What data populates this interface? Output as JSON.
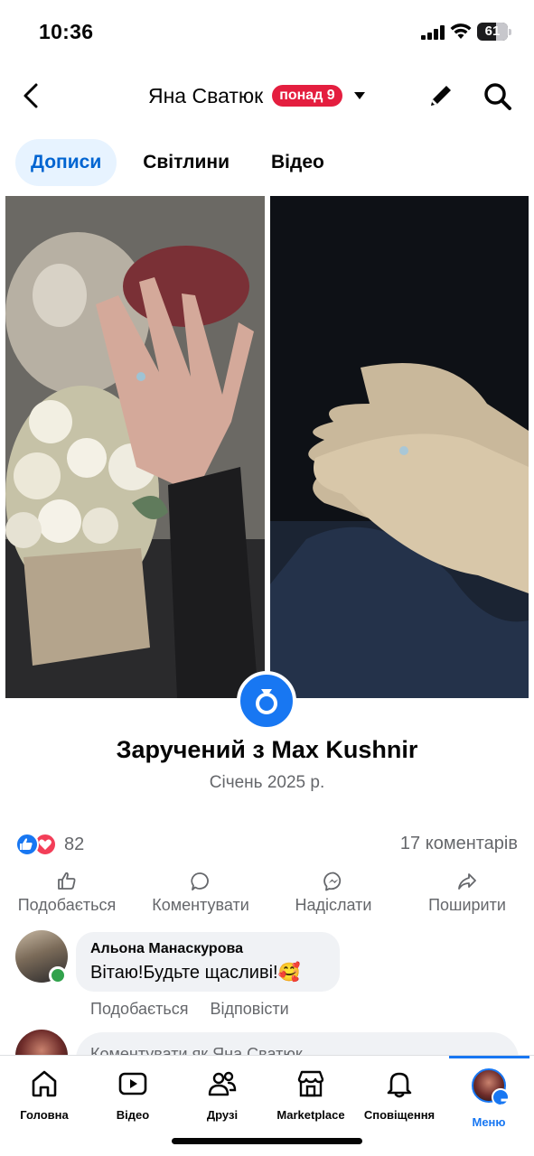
{
  "status_bar": {
    "time": "10:36",
    "battery": "61"
  },
  "header": {
    "title": "Яна Сватюк",
    "badge": "понад 9",
    "icons": [
      "back-icon",
      "chevron-down-icon",
      "edit-icon",
      "search-icon"
    ]
  },
  "tabs": [
    {
      "label": "Дописи",
      "active": true
    },
    {
      "label": "Світлини",
      "active": false
    },
    {
      "label": "Відео",
      "active": false
    }
  ],
  "post": {
    "event_title": "Заручений з Max  Kushnir",
    "event_date": "Січень 2025 р.",
    "reactions_count": "82",
    "comments_count": "17 коментарів",
    "actions": [
      "Подобається",
      "Коментувати",
      "Надіслати",
      "Поширити"
    ]
  },
  "comment": {
    "author": "Альона Манаскурова",
    "text": "Вітаю!Будьте щасливі!🥰",
    "actions": [
      "Подобається",
      "Відповісти"
    ]
  },
  "composer": {
    "placeholder": "Коментувати як Яна Сватюк"
  },
  "bottom_nav": [
    {
      "label": "Головна",
      "icon": "home-icon"
    },
    {
      "label": "Відео",
      "icon": "video-icon"
    },
    {
      "label": "Друзі",
      "icon": "friends-icon"
    },
    {
      "label": "Marketplace",
      "icon": "marketplace-icon"
    },
    {
      "label": "Сповіщення",
      "icon": "bell-icon"
    },
    {
      "label": "Меню",
      "icon": "menu-icon",
      "active": true
    }
  ],
  "colors": {
    "accent": "#1877f2",
    "badge": "#e41e3f",
    "tab_active_bg": "#e7f3ff",
    "secondary_text": "#65676b"
  }
}
